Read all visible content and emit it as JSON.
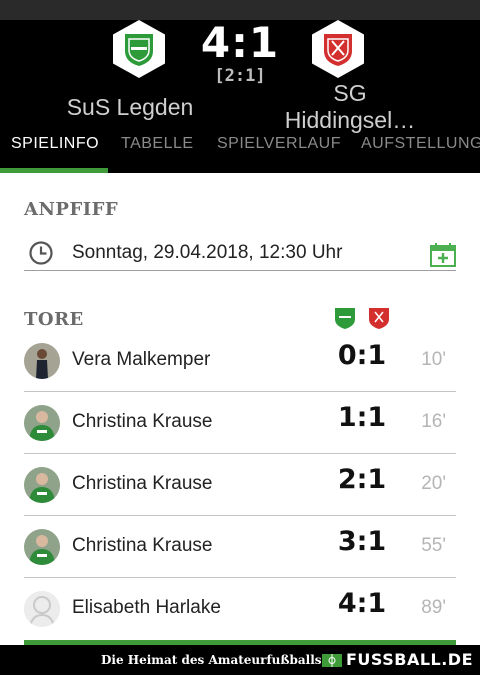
{
  "header": {
    "score": "4:1",
    "halftime": "[2:1]",
    "home_team": "SuS Legden",
    "away_team_line1": "SG",
    "away_team_line2": "Hiddingsel…",
    "home_crest_icon": "sus-legden-crest",
    "away_crest_icon": "sg-hiddingsel-crest"
  },
  "tabs": [
    {
      "label": "SPIELINFO",
      "active": true
    },
    {
      "label": "TABELLE",
      "active": false
    },
    {
      "label": "SPIELVERLAUF",
      "active": false
    },
    {
      "label": "AUFSTELLUNG",
      "active": false
    }
  ],
  "kickoff": {
    "title": "ANPFIFF",
    "datetime": "Sonntag, 29.04.2018, 12:30 Uhr",
    "clock_icon": "clock-icon",
    "calendar_icon": "calendar-add-icon"
  },
  "goals": {
    "title": "TORE",
    "items": [
      {
        "player": "Vera Malkemper",
        "score": "0:1",
        "minute": "10'"
      },
      {
        "player": "Christina Krause",
        "score": "1:1",
        "minute": "16'"
      },
      {
        "player": "Christina Krause",
        "score": "2:1",
        "minute": "20'"
      },
      {
        "player": "Christina Krause",
        "score": "3:1",
        "minute": "55'"
      },
      {
        "player": "Elisabeth Harlake",
        "score": "4:1",
        "minute": "89'"
      }
    ]
  },
  "footer": {
    "slogan": "Die Heimat des Amateurfußballs",
    "brand": "FUSSBALL.DE"
  },
  "colors": {
    "accent_green": "#3f9b37",
    "away_red": "#d32f2f",
    "header_bg": "#000000"
  }
}
